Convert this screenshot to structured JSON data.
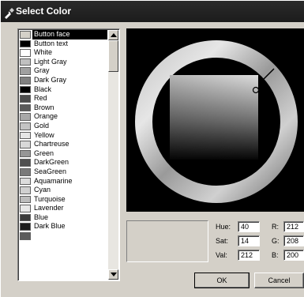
{
  "window": {
    "title": "Select Color",
    "icon": "color-picker-icon"
  },
  "color_list": {
    "selected_index": 0,
    "items": [
      {
        "label": "Button face",
        "swatch": "#d4d0c8"
      },
      {
        "label": "Button text",
        "swatch": "#000000"
      },
      {
        "label": "White",
        "swatch": "#ffffff"
      },
      {
        "label": "Light Gray",
        "swatch": "#c0c0c0"
      },
      {
        "label": "Gray",
        "swatch": "#a0a0a0"
      },
      {
        "label": "Dark Gray",
        "swatch": "#808080"
      },
      {
        "label": "Black",
        "swatch": "#000000"
      },
      {
        "label": "Red",
        "swatch": "#4c4c4c"
      },
      {
        "label": "Brown",
        "swatch": "#5a5a5a"
      },
      {
        "label": "Orange",
        "swatch": "#a8a8a8"
      },
      {
        "label": "Gold",
        "swatch": "#c4c4c4"
      },
      {
        "label": "Yellow",
        "swatch": "#e6e6e6"
      },
      {
        "label": "Chartreuse",
        "swatch": "#d8d8d8"
      },
      {
        "label": "Green",
        "swatch": "#969696"
      },
      {
        "label": "DarkGreen",
        "swatch": "#505050"
      },
      {
        "label": "SeaGreen",
        "swatch": "#7a7a7a"
      },
      {
        "label": "Aquamarine",
        "swatch": "#dcdcdc"
      },
      {
        "label": "Cyan",
        "swatch": "#d0d0d0"
      },
      {
        "label": "Turquoise",
        "swatch": "#bcbcbc"
      },
      {
        "label": "Lavender",
        "swatch": "#e8e8e8"
      },
      {
        "label": "Blue",
        "swatch": "#3a3a3a"
      },
      {
        "label": "Dark Blue",
        "swatch": "#1e1e1e"
      },
      {
        "label": "",
        "swatch": "#5c5c5c"
      }
    ]
  },
  "current_color": {
    "hue_label": "Hue:",
    "hue": "40",
    "sat_label": "Sat:",
    "sat": "14",
    "val_label": "Val:",
    "val": "212",
    "r_label": "R:",
    "r": "212",
    "g_label": "G:",
    "g": "208",
    "b_label": "B:",
    "b": "200",
    "preview_color": "#d4d0c8"
  },
  "buttons": {
    "ok": "OK",
    "cancel": "Cancel"
  },
  "icons": {
    "scroll_up": "arrow-up-icon",
    "scroll_down": "arrow-down-icon"
  }
}
